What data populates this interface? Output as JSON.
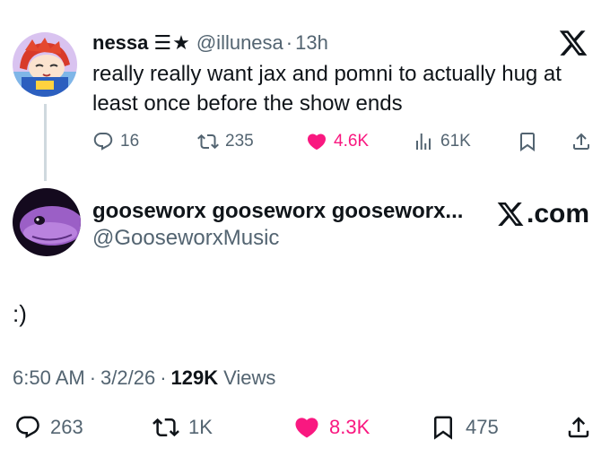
{
  "quoted_tweet": {
    "author_name": "nessa",
    "author_badge": "☰★",
    "handle": "@illunesa",
    "separator": "·",
    "time": "13h",
    "text": "really really want jax and pomni to actually hug at least once before the show ends",
    "actions": {
      "replies": "16",
      "reposts": "235",
      "likes": "4.6K",
      "views": "61K"
    },
    "icons": {
      "reply": "reply-icon",
      "repost": "repost-icon",
      "like": "heart-icon",
      "views": "views-icon",
      "bookmark": "bookmark-icon",
      "share": "share-icon",
      "brand": "x-logo-icon"
    }
  },
  "link_card": {
    "display_name": "gooseworx gooseworx gooseworx...",
    "handle": "@GooseworxMusic",
    "domain_label": ".com"
  },
  "main_tweet": {
    "text": ":)",
    "time": "6:50 AM",
    "date": "3/2/26",
    "separator": "·",
    "views_count": "129K",
    "views_label": "Views",
    "actions": {
      "replies": "263",
      "reposts": "1K",
      "likes": "8.3K",
      "bookmarks": "475"
    }
  },
  "colors": {
    "text": "#0f1419",
    "secondary": "#536471",
    "like": "#f91880",
    "divider": "#cfd9de"
  }
}
